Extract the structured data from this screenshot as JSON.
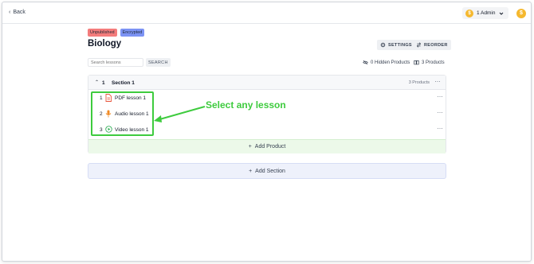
{
  "topbar": {
    "back_label": "Back",
    "admin_label": "1 Admin",
    "coin_glyph": "$"
  },
  "course": {
    "badges": [
      "Unpublished",
      "Encrypted"
    ],
    "title": "Biology",
    "settings_label": "SETTINGS",
    "reorder_label": "REORDER"
  },
  "search": {
    "placeholder": "Search lessons",
    "button_label": "SEARCH"
  },
  "meta": {
    "hidden_products": "0 Hidden Products",
    "products": "3 Products"
  },
  "section": {
    "number": "1",
    "name": "Section 1",
    "count": "3 Products",
    "lessons": [
      {
        "num": "1",
        "name": "PDF lesson 1",
        "icon": "pdf-icon"
      },
      {
        "num": "2",
        "name": "Audio lesson 1",
        "icon": "microphone-icon"
      },
      {
        "num": "3",
        "name": "Video lesson 1",
        "icon": "play-circle-icon"
      }
    ],
    "add_product_label": "Add Product"
  },
  "add_section_label": "Add Section",
  "annotation": {
    "text": "Select any lesson",
    "color": "#3ecb3e"
  },
  "colors": {
    "badge_unpublished": "#f47c7c",
    "badge_encrypted": "#7c93f4",
    "accent_coin": "#f5b82e",
    "add_product_bg": "#ecf9e9",
    "add_section_bg": "#eef1fb"
  }
}
